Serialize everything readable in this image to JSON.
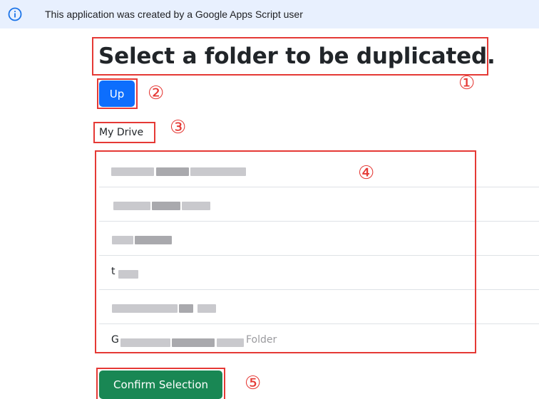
{
  "banner": {
    "icon": "info-icon",
    "text": "This application was created by a Google Apps Script user",
    "background": "#e8f0fe"
  },
  "page": {
    "title": "Select a folder to be duplicated.",
    "up_label": "Up",
    "location": "My Drive",
    "confirm_label": "Confirm Selection"
  },
  "folders": [
    {
      "visible_text": ""
    },
    {
      "visible_text": ""
    },
    {
      "visible_text": ""
    },
    {
      "visible_text": "t"
    },
    {
      "visible_text": ""
    },
    {
      "visible_text": "G",
      "visible_tail": "Folder"
    }
  ],
  "annotations": {
    "markers": [
      "①",
      "②",
      "③",
      "④",
      "⑤"
    ],
    "color": "#e53935"
  },
  "colors": {
    "primary": "#0d6efd",
    "success": "#198754",
    "divider": "#dee2e6"
  }
}
